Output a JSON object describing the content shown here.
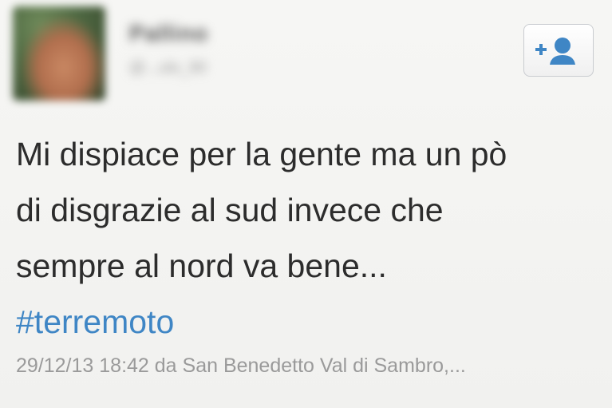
{
  "tweet": {
    "author": {
      "display_name": "Pallino",
      "handle": "@...ulo_90"
    },
    "follow_button": {
      "icon": "add-user-icon",
      "accent": "#3f86c5"
    },
    "text_lines": [
      "Mi dispiace per la gente ma un pò",
      "di disgrazie al sud invece che",
      "sempre al nord va bene..."
    ],
    "hashtag": "#terremoto",
    "meta": "29/12/13 18:42 da San Benedetto Val di Sambro,..."
  }
}
